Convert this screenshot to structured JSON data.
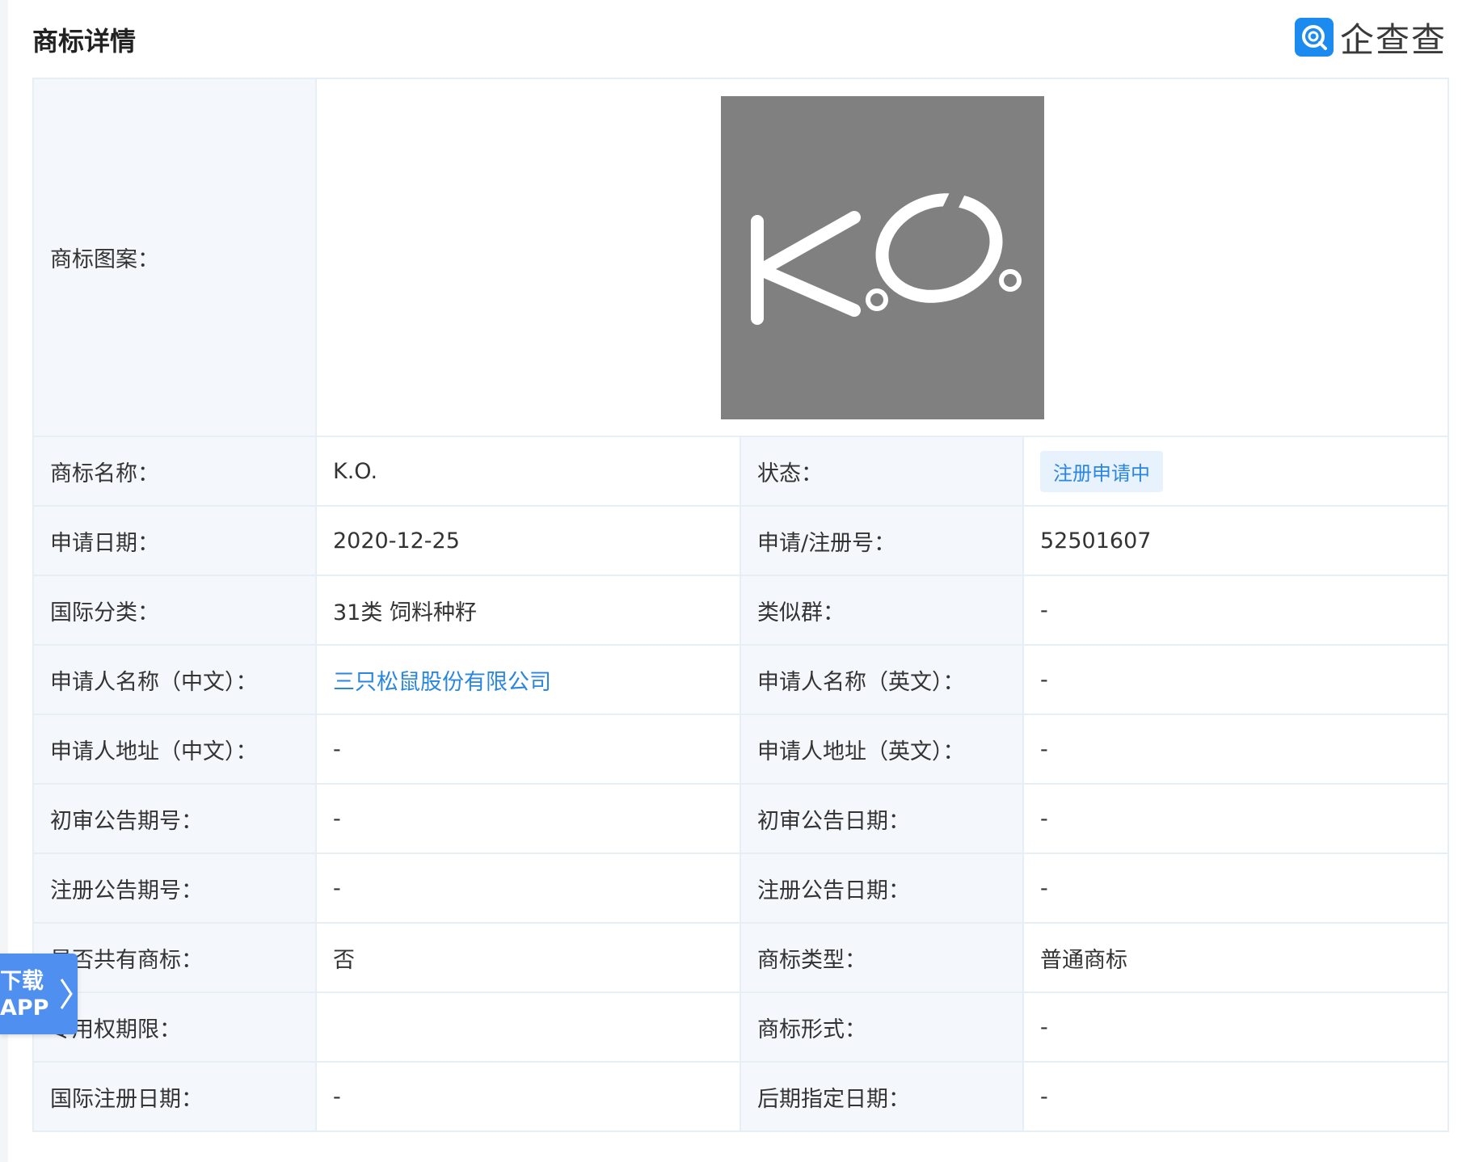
{
  "header": {
    "title": "商标详情",
    "brand_name": "企查查",
    "brand_color": "#1c8bf0"
  },
  "table": {
    "logo_label": "商标图案：",
    "logo_text": "K.O.",
    "rows": [
      {
        "l1": "商标名称：",
        "v1": "K.O.",
        "l2": "状态：",
        "v2": "注册申请中"
      },
      {
        "l1": "申请日期：",
        "v1": "2020-12-25",
        "l2": "申请/注册号：",
        "v2": "52501607"
      },
      {
        "l1": "国际分类：",
        "v1": "31类 饲料种籽",
        "l2": "类似群：",
        "v2": "-"
      },
      {
        "l1": "申请人名称（中文）：",
        "v1": "三只松鼠股份有限公司",
        "l2": "申请人名称（英文）：",
        "v2": "-"
      },
      {
        "l1": "申请人地址（中文）：",
        "v1": "-",
        "l2": "申请人地址（英文）：",
        "v2": "-"
      },
      {
        "l1": "初审公告期号：",
        "v1": "-",
        "l2": "初审公告日期：",
        "v2": "-"
      },
      {
        "l1": "注册公告期号：",
        "v1": "-",
        "l2": "注册公告日期：",
        "v2": "-"
      },
      {
        "l1": "是否共有商标：",
        "v1": "否",
        "l2": "商标类型：",
        "v2": "普通商标"
      },
      {
        "l1": "专用权期限：",
        "v1": "",
        "l2": "商标形式：",
        "v2": "-"
      },
      {
        "l1": "国际注册日期：",
        "v1": "-",
        "l2": "后期指定日期：",
        "v2": "-"
      }
    ]
  },
  "download_tab": {
    "line1": "下载",
    "line2": "APP"
  },
  "colors": {
    "label_bg": "#f4f8fc",
    "border": "#e6eef6",
    "link": "#2a86e0",
    "badge_bg": "#e7f2fd",
    "tab_bg": "#4e8ff0"
  }
}
